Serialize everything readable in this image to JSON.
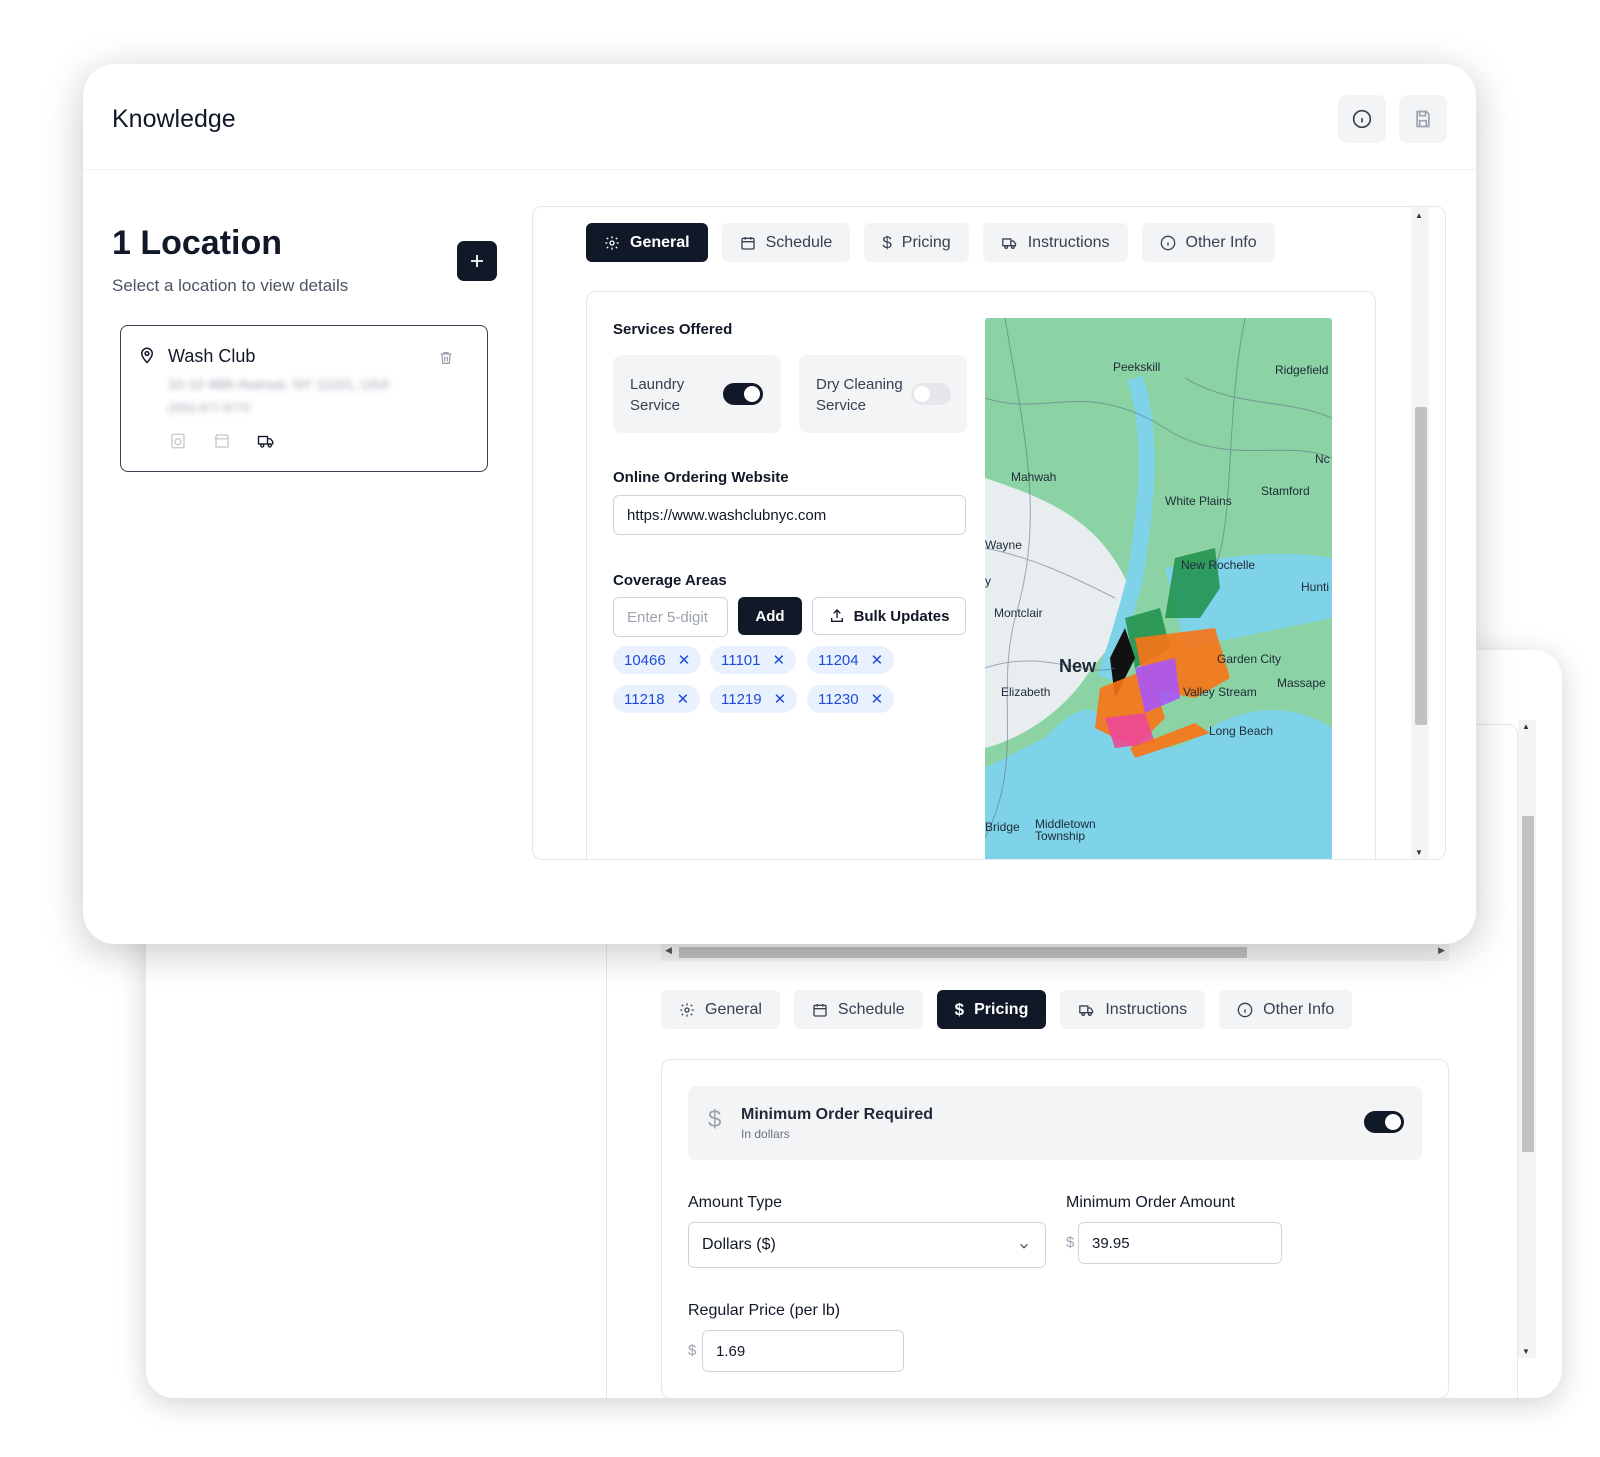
{
  "front": {
    "title": "Knowledge",
    "locations": {
      "title": "1 Location",
      "subtitle": "Select a location to view details"
    },
    "location_card": {
      "name": "Wash Club",
      "address_blurred": "10-10 48th Avenue, NY 11101, USA",
      "phone_blurred": "(555) 877-9770"
    },
    "tabs": [
      {
        "label": "General",
        "icon": "gear-icon",
        "active": true
      },
      {
        "label": "Schedule",
        "icon": "calendar-icon",
        "active": false
      },
      {
        "label": "Pricing",
        "icon": "dollar-icon",
        "active": false
      },
      {
        "label": "Instructions",
        "icon": "truck-icon",
        "active": false
      },
      {
        "label": "Other Info",
        "icon": "info-icon",
        "active": false
      }
    ],
    "services": {
      "label": "Services Offered",
      "laundry": {
        "label": "Laundry Service",
        "enabled": true
      },
      "dry_cleaning": {
        "label": "Dry Cleaning Service",
        "enabled": false
      }
    },
    "website": {
      "label": "Online Ordering Website",
      "value": "https://www.washclubnyc.com"
    },
    "coverage": {
      "label": "Coverage Areas",
      "placeholder": "Enter 5-digit",
      "add_label": "Add",
      "bulk_label": "Bulk Updates",
      "zips": [
        "10466",
        "11101",
        "11204",
        "11218",
        "11219",
        "11230"
      ]
    },
    "map_labels": [
      "Peekskill",
      "Ridgefield",
      "Mahwah",
      "White Plains",
      "Stamford",
      "Nc",
      "Wayne",
      "y",
      "New Rochelle",
      "Hunti",
      "Montclair",
      "New",
      "Garden City",
      "Elizabeth",
      "Valley Stream",
      "Massape",
      "Long Beach",
      "Bridge",
      "Middletown Township"
    ]
  },
  "back": {
    "tabs": [
      {
        "label": "General",
        "icon": "gear-icon",
        "active": false
      },
      {
        "label": "Schedule",
        "icon": "calendar-icon",
        "active": false
      },
      {
        "label": "Pricing",
        "icon": "dollar-icon",
        "active": true
      },
      {
        "label": "Instructions",
        "icon": "truck-icon",
        "active": false
      },
      {
        "label": "Other Info",
        "icon": "info-icon",
        "active": false
      }
    ],
    "min_order": {
      "title": "Minimum Order Required",
      "subtitle": "In dollars",
      "enabled": true
    },
    "amount_type": {
      "label": "Amount Type",
      "value": "Dollars ($)"
    },
    "min_amount": {
      "label": "Minimum Order Amount",
      "currency": "$",
      "value": "39.95"
    },
    "regular_price": {
      "label": "Regular Price (per lb)",
      "currency": "$",
      "value": "1.69"
    }
  },
  "colors": {
    "primary": "#111827",
    "chip_bg": "#eaf1fe",
    "chip_text": "#1d4ed8"
  }
}
